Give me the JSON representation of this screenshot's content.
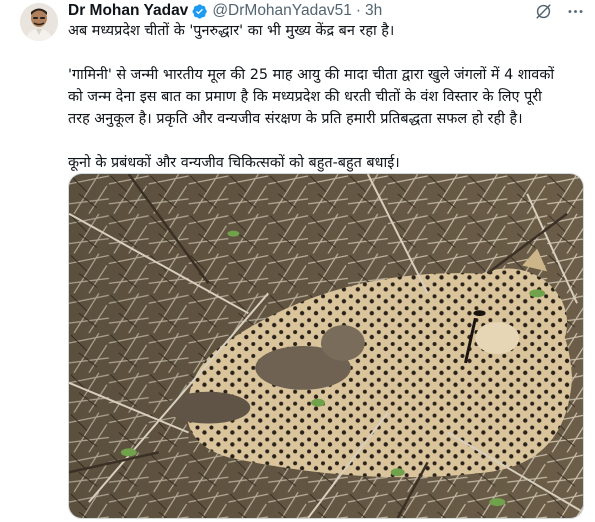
{
  "author": {
    "display_name": "Dr Mohan Yadav",
    "handle": "@DrMohanYadav51",
    "separator": "·",
    "timestamp": "3h",
    "verified_color": "#1d9bf0"
  },
  "actions": {
    "grok_icon": "grok-icon",
    "more_icon": "more-icon"
  },
  "tweet": {
    "lines": [
      "अब मध्यप्रदेश चीतों के 'पुनरुद्धार' का भी मुख्य केंद्र बन रहा है।",
      "",
      "'गामिनी' से जन्मी भारतीय मूल की 25 माह आयु की मादा चीता द्वारा खुले जंगलों में 4 शावकों",
      "को जन्म देना इस बात का प्रमाण है कि मध्यप्रदेश की धरती चीतों के वंश विस्तार के लिए पूरी",
      "तरह अनुकूल है। प्रकृति और वन्यजीव संरक्षण के प्रति हमारी प्रतिबद्धता सफल हो रही है।",
      "",
      "कूनो के प्रबंधकों और वन्यजीव चिकित्सकों को बहुत-बहुत बधाई।"
    ]
  },
  "media": {
    "kind": "photo"
  }
}
